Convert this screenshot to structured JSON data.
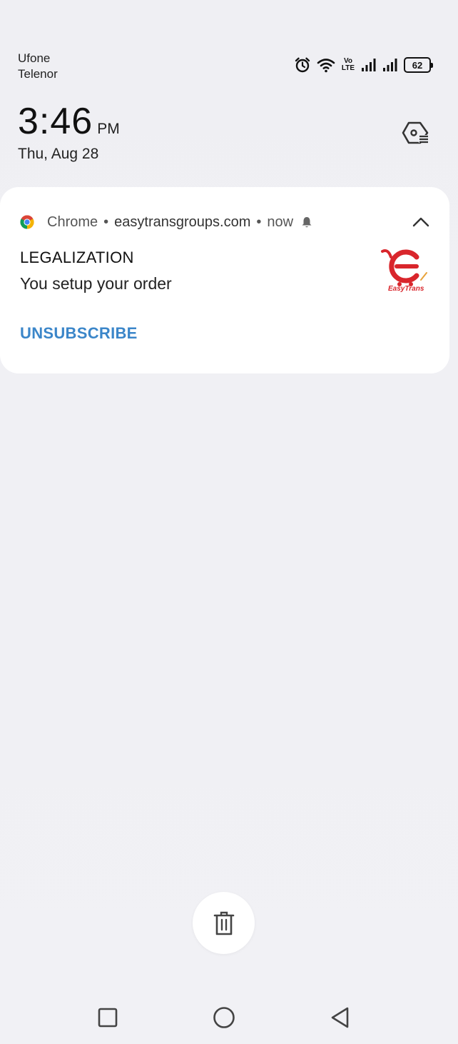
{
  "status_bar": {
    "carriers": [
      "Ufone",
      "Telenor"
    ],
    "icons": [
      "alarm-icon",
      "wifi-icon",
      "volte-icon",
      "signal-icon",
      "signal-icon",
      "battery-icon"
    ],
    "volte_top": "Vo",
    "volte_bottom": "LTE",
    "battery_level": "62"
  },
  "clock": {
    "time": "3:46",
    "ampm": "PM",
    "date": "Thu, Aug 28"
  },
  "notification": {
    "app_name": "Chrome",
    "site": "easytransgroups.com",
    "time": "now",
    "title": "LEGALIZATION",
    "body": "You setup your order",
    "action": "UNSUBSCRIBE",
    "logo_text": "EasyTrans"
  },
  "colors": {
    "action": "#3b86c9",
    "logo_red": "#d9262c",
    "logo_gold": "#e8a33a"
  }
}
